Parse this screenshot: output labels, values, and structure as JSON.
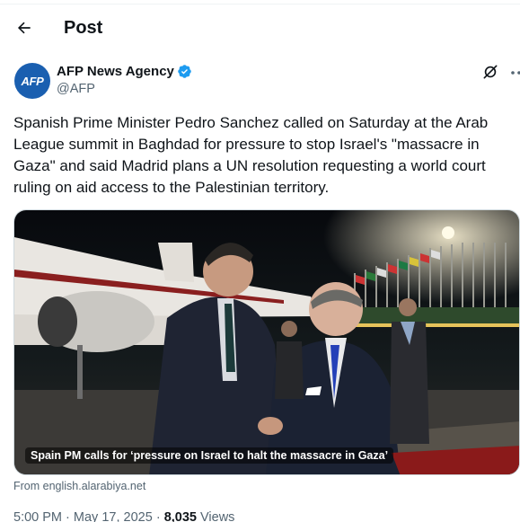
{
  "header": {
    "title": "Post"
  },
  "author": {
    "avatar_text": "AFP",
    "display_name": "AFP News Agency",
    "handle": "@AFP"
  },
  "post": {
    "text": "Spanish Prime Minister Pedro Sanchez called on Saturday at the Arab League summit in Baghdad for pressure to stop Israel's \"massacre in Gaza\" and said Madrid plans a UN resolution requesting a world court ruling on aid access to the Palestinian territory."
  },
  "card": {
    "caption": "Spain PM calls for ‘pressure on Israel to halt the massacre in Gaza’",
    "source": "From english.alarabiya.net"
  },
  "meta": {
    "time": "5:00 PM",
    "separator": "·",
    "date": "May 17, 2025",
    "views_count": "8,035",
    "views_label": "Views"
  },
  "colors": {
    "avatar_bg": "#1a5fb0",
    "verified": "#1d9bf0",
    "secondary_text": "#536471",
    "primary_text": "#0f1419"
  },
  "icons": [
    "back-arrow-icon",
    "verified-badge-icon",
    "grok-icon",
    "more-icon"
  ]
}
